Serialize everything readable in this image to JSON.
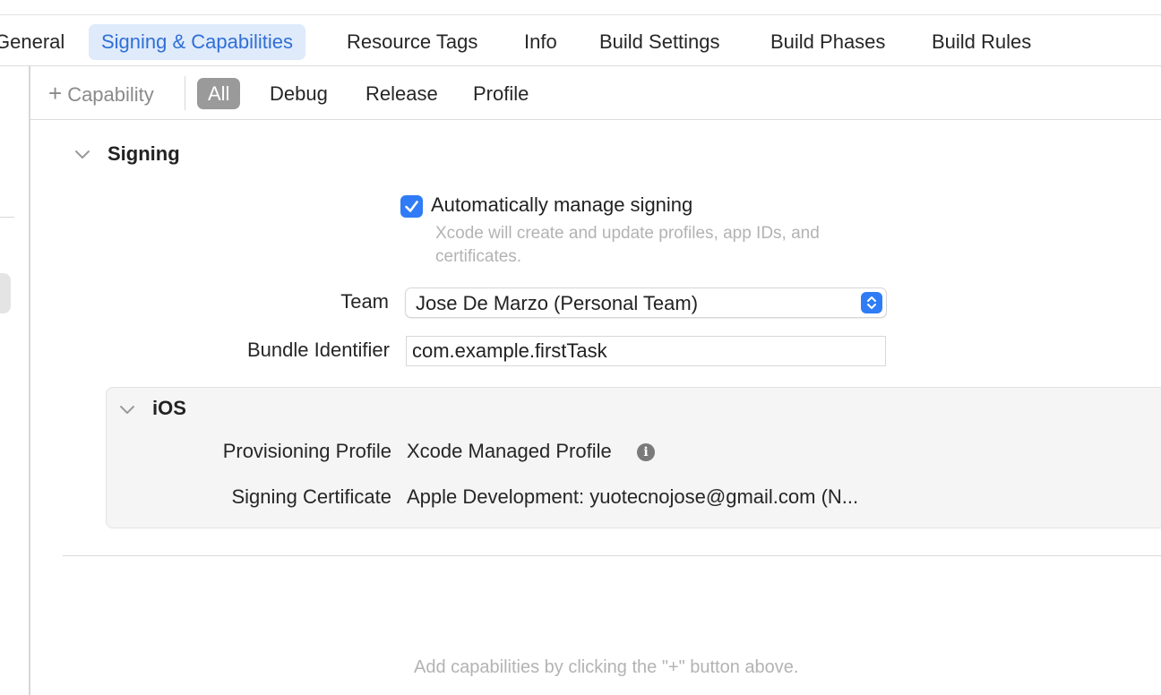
{
  "tabs": [
    {
      "label": "General"
    },
    {
      "label": "Signing & Capabilities"
    },
    {
      "label": "Resource Tags"
    },
    {
      "label": "Info"
    },
    {
      "label": "Build Settings"
    },
    {
      "label": "Build Phases"
    },
    {
      "label": "Build Rules"
    }
  ],
  "active_tab": "Signing & Capabilities",
  "capability_toolbar": {
    "add_label": "Capability",
    "filters": [
      {
        "label": "All"
      },
      {
        "label": "Debug"
      },
      {
        "label": "Release"
      },
      {
        "label": "Profile"
      }
    ],
    "active_filter": "All"
  },
  "signing": {
    "title": "Signing",
    "auto_manage": {
      "label": "Automatically manage signing",
      "checked": true,
      "description": "Xcode will create and update profiles, app IDs, and certificates."
    },
    "team": {
      "label": "Team",
      "value": "Jose De Marzo (Personal Team)"
    },
    "bundle_identifier": {
      "label": "Bundle Identifier",
      "value": "com.example.firstTask"
    },
    "ios": {
      "title": "iOS",
      "provisioning_profile": {
        "label": "Provisioning Profile",
        "value": "Xcode Managed Profile"
      },
      "signing_certificate": {
        "label": "Signing Certificate",
        "value": "Apple Development: yuotecnojose@gmail.com (N..."
      }
    }
  },
  "hint": "Add capabilities by clicking the \"+\" button above.",
  "colors": {
    "accent": "#2f7cf6",
    "active_tab_bg": "#dfeafb",
    "active_tab_text": "#2f6fd6",
    "active_filter_bg": "#9a9a9a"
  },
  "icons": {
    "disclosure": "chevron-down-icon",
    "info": "info-icon",
    "popup": "popup-stepper-icon",
    "add": "plus-icon",
    "checkbox": "checkmark-icon"
  }
}
